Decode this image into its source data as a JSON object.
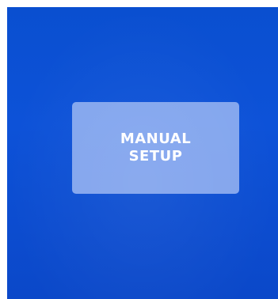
{
  "colors": {
    "screen_background": "#0c4fd4",
    "button_background": "#a5bef5",
    "button_text": "#ffffff"
  },
  "button": {
    "line1": "MANUAL",
    "line2": "SETUP"
  }
}
